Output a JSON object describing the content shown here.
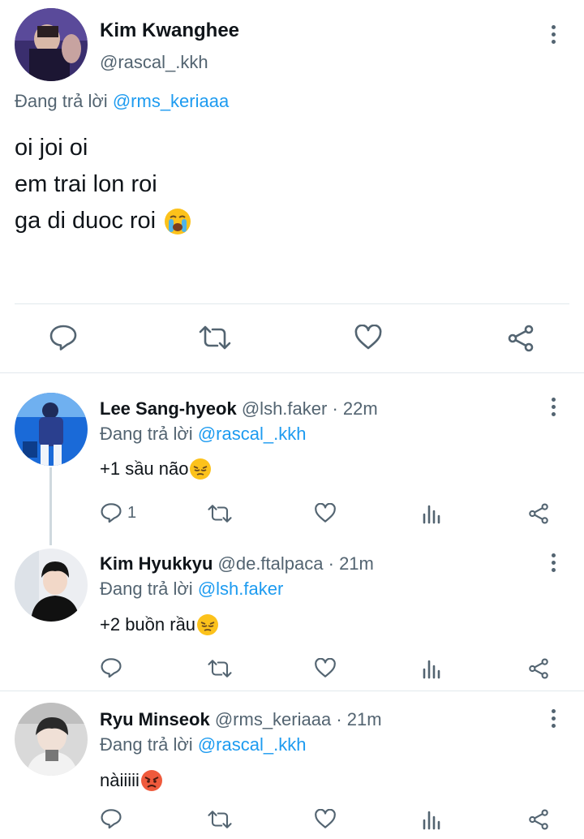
{
  "main_tweet": {
    "author_name": "Kim Kwanghee",
    "author_handle": "@rascal_.kkh",
    "replying_prefix": "Đang trả lời",
    "replying_to": "@rms_keriaaa",
    "lines": [
      "oi joi oi",
      "em trai lon roi",
      "ga di duoc roi"
    ],
    "emoji": "loudly-crying-face"
  },
  "replies": [
    {
      "name": "Lee Sang-hyeok",
      "handle": "@lsh.faker",
      "time": "· 22m",
      "replying_prefix": "Đang trả lời",
      "replying_to": "@rascal_.kkh",
      "text": "+1 sầu não",
      "emoji": "pensive-face",
      "reply_count": "1"
    },
    {
      "name": "Kim Hyukkyu",
      "handle": "@de.ftalpaca",
      "time": "· 21m",
      "replying_prefix": "Đang trả lời",
      "replying_to": "@lsh.faker",
      "text": "+2 buồn rầu",
      "emoji": "pensive-face",
      "reply_count": ""
    },
    {
      "name": "Ryu Minseok",
      "handle": "@rms_keriaaa",
      "time": "· 21m",
      "replying_prefix": "Đang trả lời",
      "replying_to": "@rascal_.kkh",
      "text": "nàiiiii",
      "emoji": "angry-face",
      "reply_count": ""
    }
  ],
  "colors": {
    "text": "#0f1419",
    "secondary": "#536471",
    "link": "#1d9bf0",
    "divider": "#e1e8ed"
  }
}
